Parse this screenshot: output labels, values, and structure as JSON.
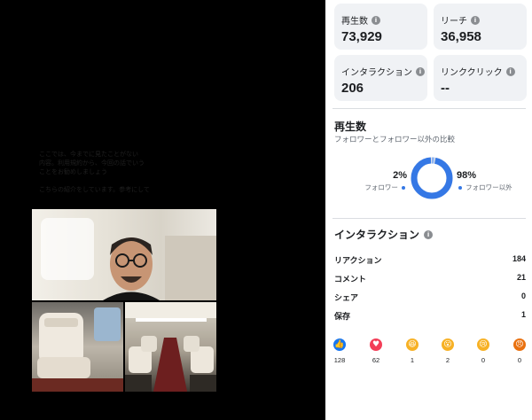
{
  "caption_lines": [
    "ここでは、今までに見たことがない",
    "内容。利用規約から、今回の話でいう",
    "ことをお勧めしましょう",
    "",
    "こちらの紹介をしています。参考にして"
  ],
  "media": {
    "photos": [
      "selfie-in-train",
      "train-seat",
      "train-aisle"
    ]
  },
  "stats": {
    "plays": {
      "label": "再生数",
      "value": "73,929"
    },
    "reach": {
      "label": "リーチ",
      "value": "36,958"
    },
    "interactions": {
      "label": "インタラクション",
      "value": "206"
    },
    "link_clicks": {
      "label": "リンククリック",
      "value": "--"
    }
  },
  "plays_section": {
    "title": "再生数",
    "subtitle": "フォロワーとフォロワー以外の比較",
    "followers": {
      "pct": "2%",
      "label": "フォロワー",
      "value": 2,
      "color": "#3578e5"
    },
    "non_followers": {
      "pct": "98%",
      "label": "フォロワー以外",
      "value": 98,
      "color": "#3578e5"
    }
  },
  "interactions_section": {
    "title": "インタラクション",
    "rows": [
      {
        "label": "リアクション",
        "value": "184"
      },
      {
        "label": "コメント",
        "value": "21"
      },
      {
        "label": "シェア",
        "value": "0"
      },
      {
        "label": "保存",
        "value": "1"
      }
    ],
    "reactions": [
      {
        "name": "like",
        "count": "128",
        "color": "#1877f2",
        "glyph": "👍"
      },
      {
        "name": "love",
        "count": "62",
        "color": "#f33e58",
        "glyph": "♥"
      },
      {
        "name": "haha",
        "count": "1",
        "color": "#f7b125",
        "glyph": "😆"
      },
      {
        "name": "wow",
        "count": "2",
        "color": "#f7b125",
        "glyph": "😮"
      },
      {
        "name": "sad",
        "count": "0",
        "color": "#f7b125",
        "glyph": "😢"
      },
      {
        "name": "angry",
        "count": "0",
        "color": "#e9710f",
        "glyph": "😠"
      }
    ]
  }
}
